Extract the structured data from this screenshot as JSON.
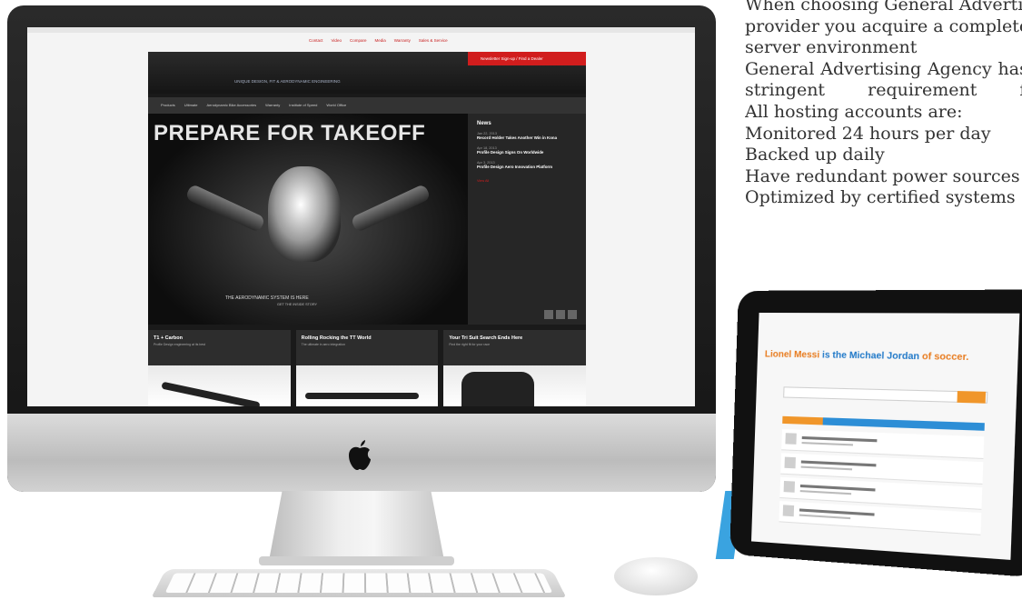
{
  "copy": {
    "lines": [
      "When choosing General Advertising Agency as your hosting",
      "provider you acquire a complete",
      "server environment",
      "General Advertising Agency has a",
      "stringent requirement for",
      "All hosting accounts are:",
      "Monitored 24 hours per day",
      "Backed up daily",
      "Have redundant power sources",
      "Optimized by certified systems"
    ]
  },
  "imac_site": {
    "top_nav": [
      "Contact",
      "Video",
      "Compare",
      "Media",
      "Warranty",
      "Sales & Service"
    ],
    "tagline": "UNIQUE DESIGN, FIT & AERODYNAMIC ENGINEERING",
    "header_button": "Newsletter Sign-up / Find a Dealer",
    "nav": [
      "Products",
      "Ultimate",
      "Aerodynamic Bike Accessories",
      "Warranty",
      "Institute of Speed",
      "World Office"
    ],
    "hero_title": "PREPARE FOR TAKEOFF",
    "hero_sub": "THE AERODYNAMIC SYSTEM IS HERE",
    "hero_sub2": "GET THE INSIDE STORY",
    "news_heading": "News",
    "news": [
      {
        "date": "Jan 22, 2013",
        "title": "Record Holder Takes Another Win in Kona"
      },
      {
        "date": "Apr 18, 2013",
        "title": "Profile Design Signs On Worldwide"
      },
      {
        "date": "Apr 3, 2013",
        "title": "Profile Design Aero Innovation Platform"
      }
    ],
    "news_more": "View All",
    "promos": [
      {
        "title": "T1 + Carbon",
        "desc": "Profile Design engineering at its best"
      },
      {
        "title": "Rolling Rocking the TT World",
        "desc": "The ultimate in aero integration"
      },
      {
        "title": "Your Tri Suit Search Ends Here",
        "desc": "Find the right fit for your race"
      }
    ]
  },
  "ipad": {
    "headline_a": "Lionel Messi",
    "headline_b": " is the Michael Jordan",
    "headline_c": " of soccer."
  }
}
